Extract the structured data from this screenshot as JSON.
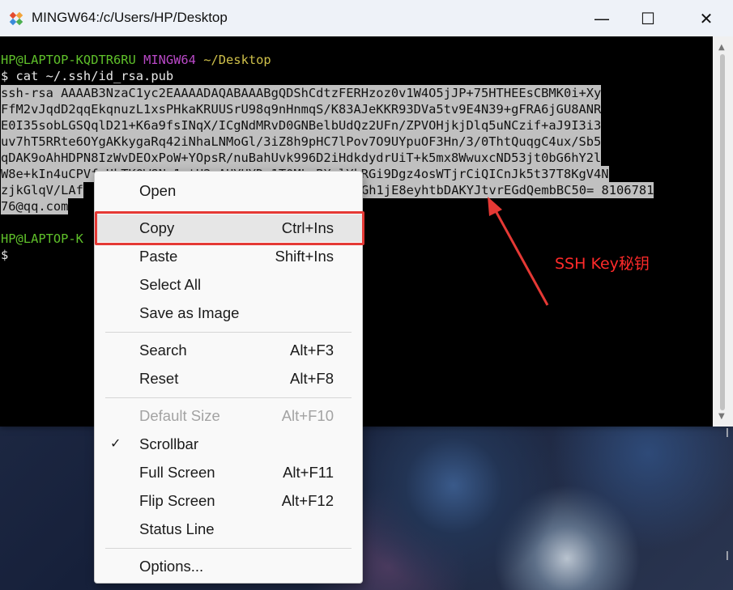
{
  "window": {
    "title": "MINGW64:/c/Users/HP/Desktop",
    "minimize_glyph": "—",
    "maximize_glyph": "☐",
    "close_glyph": "✕"
  },
  "terminal": {
    "prompt1_user": "HP@LAPTOP-KQDTR6RU",
    "prompt1_shell": "MINGW64",
    "prompt1_path": "~/Desktop",
    "command": "$ cat ~/.ssh/id_rsa.pub",
    "key_lines": [
      "ssh-rsa AAAAB3NzaC1yc2EAAAADAQABAAABgQDShCdtzFERHzoz0v1W4O5jJP+75HTHEEsCBMK0i+Xy",
      "FfM2vJqdD2qqEkqnuzL1xsPHkaKRUUSrU98q9nHnmqS/K83AJeKKR93DVa5tv9E4N39+gFRA6jGU8ANR",
      "E0I35sobLGSQqlD21+K6a9fsINqX/ICgNdMRvD0GNBelbUdQz2UFn/ZPVOHjkjDlq5uNCzif+aJ9I3i3",
      "uv7hT5RRte6OYgAKkygaRq42iNhaLNMoGl/3iZ8h9pHC7lPov7O9UYpuOF3Hn/3/0ThtQuqgC4ux/Sb5",
      "qDAK9oAhHDPN8IzWvDEOxPoW+YOpsR/nuBahUvk996D2iHdkdydrUiT+k5mx8WwuxcND53jt0bG6hY2l",
      "W8e+kIn4uCPVfyUkTKOW8Na1otH2wAUYUYDr1T0ML BX+lYkRGi9Dgz4osWTjrCiQICnJk5t37T8KgV4N",
      "zjkGlqV/LAf",
      "76@qq.com"
    ],
    "key_line7_tail": "Gh1jE8eyhtbDAKYJtvrEGdQembBC50= 8106781",
    "prompt2_user": "HP@LAPTOP-K",
    "prompt2_cursor": "$"
  },
  "context_menu": {
    "items": [
      {
        "label": "Open",
        "shortcut": ""
      },
      {
        "label": "Copy",
        "shortcut": "Ctrl+Ins"
      },
      {
        "label": "Paste",
        "shortcut": "Shift+Ins"
      },
      {
        "label": "Select All",
        "shortcut": ""
      },
      {
        "label": "Save as Image",
        "shortcut": ""
      },
      {
        "label": "Search",
        "shortcut": "Alt+F3"
      },
      {
        "label": "Reset",
        "shortcut": "Alt+F8"
      },
      {
        "label": "Default Size",
        "shortcut": "Alt+F10"
      },
      {
        "label": "Scrollbar",
        "shortcut": ""
      },
      {
        "label": "Full Screen",
        "shortcut": "Alt+F11"
      },
      {
        "label": "Flip Screen",
        "shortcut": "Alt+F12"
      },
      {
        "label": "Status Line",
        "shortcut": ""
      },
      {
        "label": "Options...",
        "shortcut": ""
      }
    ],
    "check_glyph": "✓"
  },
  "annotation": {
    "text": "SSH Key秘钥",
    "color": "#ff2a2a"
  },
  "colors": {
    "prompt_user": "#5fc02a",
    "prompt_shell": "#b948c7",
    "prompt_path": "#cfc04a",
    "selection_bg": "#c0c0c0",
    "highlight_box": "#e53935"
  }
}
